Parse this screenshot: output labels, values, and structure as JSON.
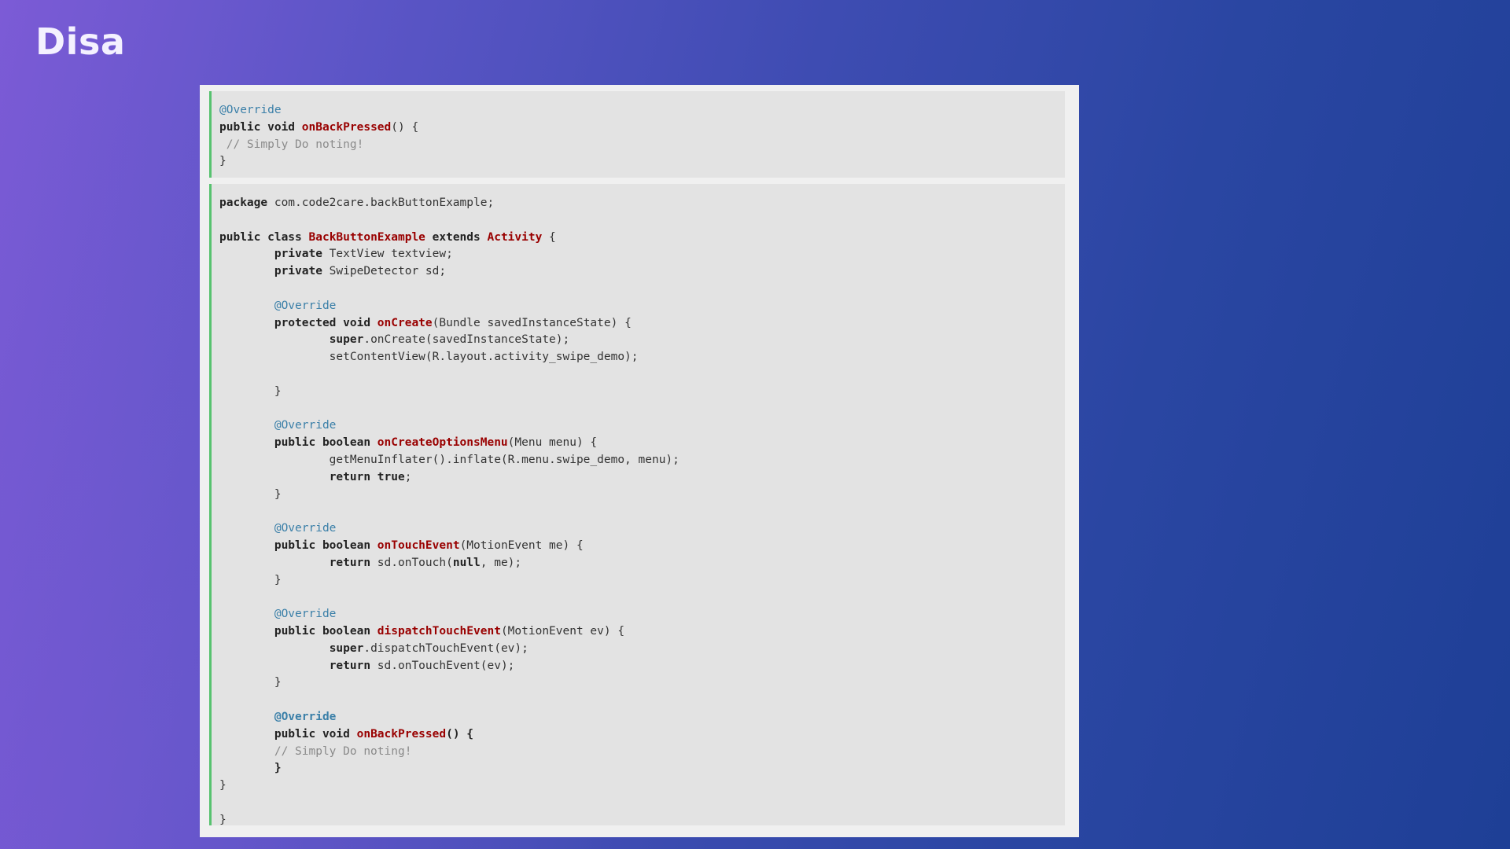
{
  "slide": {
    "title": "Disa"
  },
  "code_blocks": [
    {
      "lines": [
        [
          {
            "t": "@Override",
            "c": "ann"
          }
        ],
        [
          {
            "t": "public void ",
            "c": "kw"
          },
          {
            "t": "onBackPressed",
            "c": "fn"
          },
          {
            "t": "() {",
            "c": ""
          }
        ],
        [
          {
            "t": " // Simply Do noting!",
            "c": "cm"
          }
        ],
        [
          {
            "t": "}",
            "c": ""
          }
        ]
      ]
    },
    {
      "lines": [
        [
          {
            "t": "package",
            "c": "kw"
          },
          {
            "t": " com.code2care.backButtonExample;",
            "c": ""
          }
        ],
        [],
        [
          {
            "t": "public class ",
            "c": "kw"
          },
          {
            "t": "BackButtonExample",
            "c": "fn"
          },
          {
            "t": " extends ",
            "c": "kw"
          },
          {
            "t": "Activity",
            "c": "fn"
          },
          {
            "t": " {",
            "c": ""
          }
        ],
        [
          {
            "t": "        ",
            "c": ""
          },
          {
            "t": "private",
            "c": "kw"
          },
          {
            "t": " TextView textview;",
            "c": ""
          }
        ],
        [
          {
            "t": "        ",
            "c": ""
          },
          {
            "t": "private",
            "c": "kw"
          },
          {
            "t": " SwipeDetector sd;",
            "c": ""
          }
        ],
        [],
        [
          {
            "t": "        ",
            "c": ""
          },
          {
            "t": "@Override",
            "c": "ann"
          }
        ],
        [
          {
            "t": "        ",
            "c": ""
          },
          {
            "t": "protected void ",
            "c": "kw"
          },
          {
            "t": "onCreate",
            "c": "fn"
          },
          {
            "t": "(Bundle savedInstanceState) {",
            "c": ""
          }
        ],
        [
          {
            "t": "                ",
            "c": ""
          },
          {
            "t": "super",
            "c": "kw"
          },
          {
            "t": ".onCreate(savedInstanceState);",
            "c": ""
          }
        ],
        [
          {
            "t": "                setContentView(R.layout.activity_swipe_demo);",
            "c": ""
          }
        ],
        [],
        [
          {
            "t": "        }",
            "c": ""
          }
        ],
        [],
        [
          {
            "t": "        ",
            "c": ""
          },
          {
            "t": "@Override",
            "c": "ann"
          }
        ],
        [
          {
            "t": "        ",
            "c": ""
          },
          {
            "t": "public boolean ",
            "c": "kw"
          },
          {
            "t": "onCreateOptionsMenu",
            "c": "fn"
          },
          {
            "t": "(Menu menu) {",
            "c": ""
          }
        ],
        [
          {
            "t": "                getMenuInflater().inflate(R.menu.swipe_demo, menu);",
            "c": ""
          }
        ],
        [
          {
            "t": "                ",
            "c": ""
          },
          {
            "t": "return true",
            "c": "kw"
          },
          {
            "t": ";",
            "c": ""
          }
        ],
        [
          {
            "t": "        }",
            "c": ""
          }
        ],
        [],
        [
          {
            "t": "        ",
            "c": ""
          },
          {
            "t": "@Override",
            "c": "ann"
          }
        ],
        [
          {
            "t": "        ",
            "c": ""
          },
          {
            "t": "public boolean ",
            "c": "kw"
          },
          {
            "t": "onTouchEvent",
            "c": "fn"
          },
          {
            "t": "(MotionEvent me) {",
            "c": ""
          }
        ],
        [
          {
            "t": "                ",
            "c": ""
          },
          {
            "t": "return",
            "c": "kw"
          },
          {
            "t": " sd.onTouch(",
            "c": ""
          },
          {
            "t": "null",
            "c": "kw"
          },
          {
            "t": ", me);",
            "c": ""
          }
        ],
        [
          {
            "t": "        }",
            "c": ""
          }
        ],
        [],
        [
          {
            "t": "        ",
            "c": ""
          },
          {
            "t": "@Override",
            "c": "ann"
          }
        ],
        [
          {
            "t": "        ",
            "c": ""
          },
          {
            "t": "public boolean ",
            "c": "kw"
          },
          {
            "t": "dispatchTouchEvent",
            "c": "fn"
          },
          {
            "t": "(MotionEvent ev) {",
            "c": ""
          }
        ],
        [
          {
            "t": "                ",
            "c": ""
          },
          {
            "t": "super",
            "c": "kw"
          },
          {
            "t": ".dispatchTouchEvent(ev);",
            "c": ""
          }
        ],
        [
          {
            "t": "                ",
            "c": ""
          },
          {
            "t": "return",
            "c": "kw"
          },
          {
            "t": " sd.onTouchEvent(ev);",
            "c": ""
          }
        ],
        [
          {
            "t": "        }",
            "c": ""
          }
        ],
        [],
        [
          {
            "t": "        ",
            "c": ""
          },
          {
            "t": "@Override",
            "c": "ann-b"
          }
        ],
        [
          {
            "t": "        ",
            "c": ""
          },
          {
            "t": "public void ",
            "c": "kw"
          },
          {
            "t": "onBackPressed",
            "c": "fn"
          },
          {
            "t": "() {",
            "c": "kw"
          }
        ],
        [
          {
            "t": "        ",
            "c": ""
          },
          {
            "t": "// Simply Do noting!",
            "c": "cm"
          }
        ],
        [
          {
            "t": "        ",
            "c": ""
          },
          {
            "t": "}",
            "c": "kw"
          }
        ],
        [
          {
            "t": "}",
            "c": ""
          }
        ],
        [],
        [
          {
            "t": "}",
            "c": ""
          }
        ]
      ]
    }
  ],
  "colors": {
    "background_left": "#7c5bd6",
    "background_right": "#1e3f96",
    "panel": "#f0f0f0",
    "code_background": "#e3e3e3",
    "code_border": "#57c26f",
    "keyword": "#222222",
    "identifier": "#990000",
    "annotation": "#3a7fa8",
    "comment": "#8a8a8a"
  }
}
